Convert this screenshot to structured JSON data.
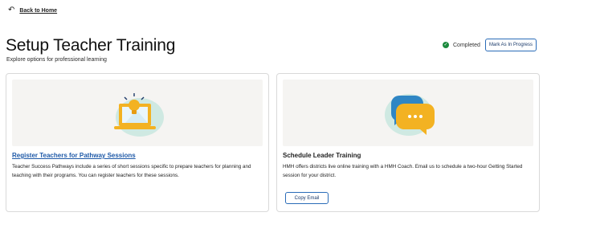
{
  "nav": {
    "back_label": "Back to Home"
  },
  "header": {
    "title": "Setup Teacher Training",
    "subtitle": "Explore options for professional learning",
    "status_label": "Completed",
    "mark_button_label": "Mark As In Progress"
  },
  "cards": [
    {
      "title": "Register Teachers for Pathway Sessions",
      "body": "Teacher Success Pathways include a series of short sessions specific to prepare teachers for planning and teaching with their programs. You can register teachers for these sessions.",
      "illustration": "laptop-lightbulb-icon"
    },
    {
      "title": "Schedule Leader Training",
      "body": "HMH offers districts live online training with a HMH Coach. Email us to schedule a two-hour Getting Started session for your district.",
      "button_label": "Copy Email",
      "illustration": "chat-bubbles-icon"
    }
  ],
  "colors": {
    "accent": "#2a6cb8",
    "link": "#1f5aa8",
    "success": "#1b8a3d",
    "illustration_bg": "#cfe9e2",
    "illustration_yellow": "#f3b222",
    "illustration_blue": "#2f86c4"
  }
}
